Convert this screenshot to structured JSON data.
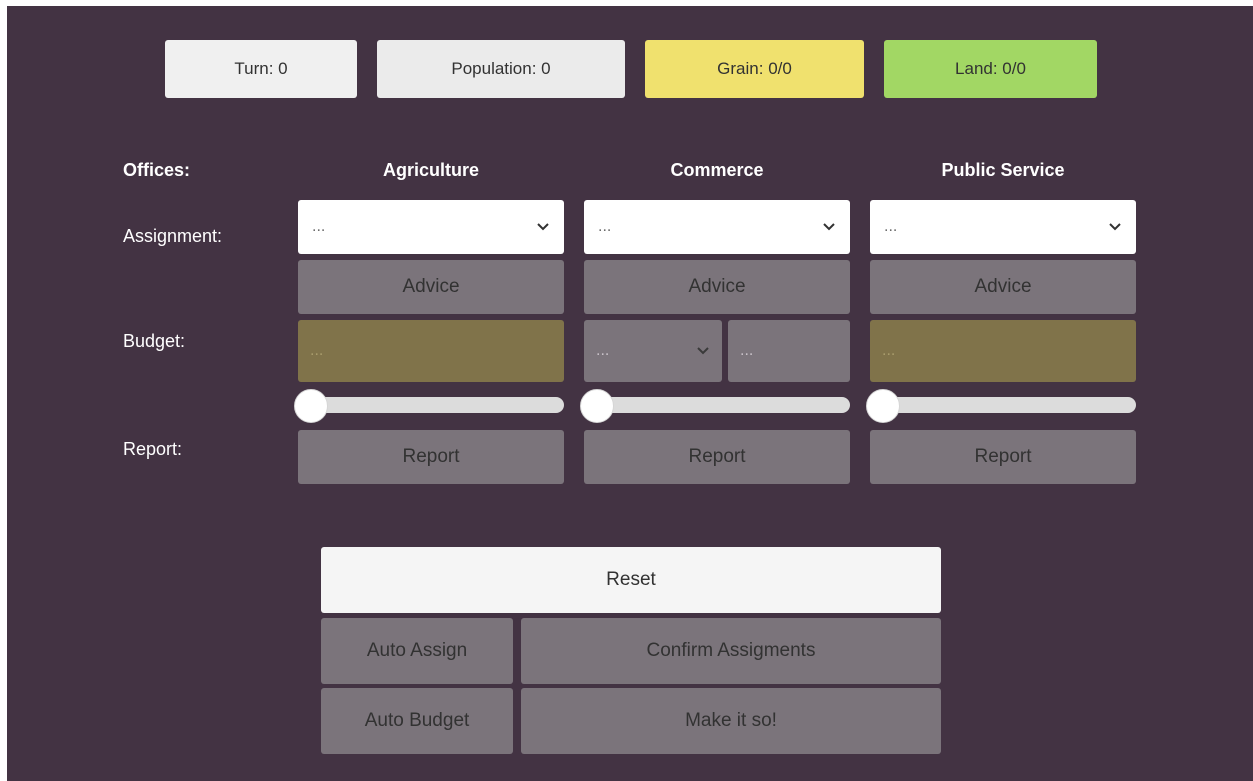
{
  "stats": {
    "turn": "Turn: 0",
    "population": "Population: 0",
    "grain": "Grain: 0/0",
    "land": "Land: 0/0"
  },
  "colors": {
    "background": "#433343",
    "grain": "#f0e16e",
    "land": "#a2d764",
    "button": "#7b747b",
    "budget_field": "#80734a"
  },
  "rows": {
    "offices": "Offices:",
    "assignment": "Assignment:",
    "budget": "Budget:",
    "report": "Report:"
  },
  "offices": [
    {
      "name": "Agriculture",
      "assignment": "...",
      "advice": "Advice",
      "budget": "...",
      "report": "Report",
      "slider": 0
    },
    {
      "name": "Commerce",
      "assignment": "...",
      "advice": "Advice",
      "budget_select": "...",
      "budget": "...",
      "report": "Report",
      "slider": 0
    },
    {
      "name": "Public Service",
      "assignment": "...",
      "advice": "Advice",
      "budget": "...",
      "report": "Report",
      "slider": 0
    }
  ],
  "actions": {
    "reset": "Reset",
    "auto_assign": "Auto Assign",
    "confirm": "Confirm Assigments",
    "auto_budget": "Auto Budget",
    "make_it_so": "Make it so!"
  },
  "icons": {
    "dropdown": "chevron-down-icon"
  }
}
